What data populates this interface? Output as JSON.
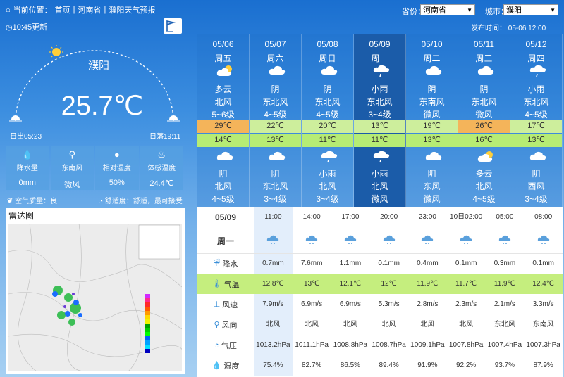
{
  "breadcrumb": {
    "prefix": "当前位置：",
    "home": "首页",
    "province": "河南省",
    "page": "濮阳天气预报"
  },
  "selectors": {
    "province_label": "省份：",
    "province_value": "河南省",
    "city_label": "城市：",
    "city_value": "濮阳"
  },
  "update_time": "10:45更新",
  "publish": "发布时间：  05-06 12:00",
  "current": {
    "city": "濮阳",
    "temp": "25.7℃",
    "sunrise": "日出05:23",
    "sunset": "日落19:11"
  },
  "details": [
    {
      "label": "降水量",
      "value": "0mm",
      "icon": "raindrops-icon"
    },
    {
      "label": "东南风",
      "value": "微风",
      "icon": "wind-turbine-icon"
    },
    {
      "label": "相对湿度",
      "value": "50%",
      "icon": "drop-icon"
    },
    {
      "label": "体感温度",
      "value": "24.4℃",
      "icon": "thermo-icon"
    }
  ],
  "aqi": "空气质量：良",
  "comfort": "舒适度：舒适，最可接受",
  "radar_title": "雷达图",
  "daily": [
    {
      "date": "05/06",
      "weekday": "周五",
      "day_weather": "多云",
      "day_wind": "北风",
      "day_level": "5~6级",
      "high": "29℃",
      "low": "14℃",
      "night_weather": "阴",
      "night_wind": "北风",
      "night_level": "4~5级"
    },
    {
      "date": "05/07",
      "weekday": "周六",
      "day_weather": "阴",
      "day_wind": "东北风",
      "day_level": "4~5级",
      "high": "22℃",
      "low": "13℃",
      "night_weather": "阴",
      "night_wind": "东北风",
      "night_level": "3~4级"
    },
    {
      "date": "05/08",
      "weekday": "周日",
      "day_weather": "阴",
      "day_wind": "东北风",
      "day_level": "4~5级",
      "high": "20℃",
      "low": "11℃",
      "night_weather": "小雨",
      "night_wind": "北风",
      "night_level": "3~4级"
    },
    {
      "date": "05/09",
      "weekday": "周一",
      "day_weather": "小雨",
      "day_wind": "东北风",
      "day_level": "3~4级",
      "high": "13℃",
      "low": "11℃",
      "night_weather": "小雨",
      "night_wind": "北风",
      "night_level": "微风"
    },
    {
      "date": "05/10",
      "weekday": "周二",
      "day_weather": "阴",
      "day_wind": "东南风",
      "day_level": "微风",
      "high": "19℃",
      "low": "13℃",
      "night_weather": "阴",
      "night_wind": "东风",
      "night_level": "微风"
    },
    {
      "date": "05/11",
      "weekday": "周三",
      "day_weather": "阴",
      "day_wind": "东北风",
      "day_level": "微风",
      "high": "26℃",
      "low": "16℃",
      "night_weather": "多云",
      "night_wind": "北风",
      "night_level": "4~5级"
    },
    {
      "date": "05/12",
      "weekday": "周四",
      "day_weather": "小雨",
      "day_wind": "东北风",
      "day_level": "4~5级",
      "high": "17℃",
      "low": "13℃",
      "night_weather": "阴",
      "night_wind": "西风",
      "night_level": "3~4级"
    }
  ],
  "hourly": {
    "date": "05/09",
    "weekday": "周一",
    "times": [
      "11:00",
      "14:00",
      "17:00",
      "20:00",
      "23:00",
      "10日02:00",
      "05:00",
      "08:00"
    ],
    "rows": [
      {
        "label": "降水",
        "values": [
          "0.7mm",
          "7.6mm",
          "1.1mm",
          "0.1mm",
          "0.4mm",
          "0.1mm",
          "0.3mm",
          "0.1mm"
        ]
      },
      {
        "label": "气温",
        "values": [
          "12.8℃",
          "13℃",
          "12.1℃",
          "12℃",
          "11.9℃",
          "11.7℃",
          "11.9℃",
          "12.4℃"
        ]
      },
      {
        "label": "风速",
        "values": [
          "7.9m/s",
          "6.9m/s",
          "6.9m/s",
          "5.3m/s",
          "2.8m/s",
          "2.3m/s",
          "2.1m/s",
          "3.3m/s"
        ]
      },
      {
        "label": "风向",
        "values": [
          "北风",
          "北风",
          "北风",
          "北风",
          "北风",
          "北风",
          "东北风",
          "东南风"
        ]
      },
      {
        "label": "气压",
        "values": [
          "1013.2hPa",
          "1011.1hPa",
          "1008.8hPa",
          "1008.7hPa",
          "1009.1hPa",
          "1007.8hPa",
          "1007.4hPa",
          "1007.3hPa"
        ]
      },
      {
        "label": "湿度",
        "values": [
          "75.4%",
          "82.7%",
          "86.5%",
          "89.4%",
          "91.9%",
          "92.2%",
          "93.7%",
          "87.9%"
        ]
      }
    ]
  },
  "colors": {
    "warm": "#f4b45a",
    "mild": "#cdee9c",
    "cool": "#b6ec74",
    "active": "#1b5ca9"
  }
}
